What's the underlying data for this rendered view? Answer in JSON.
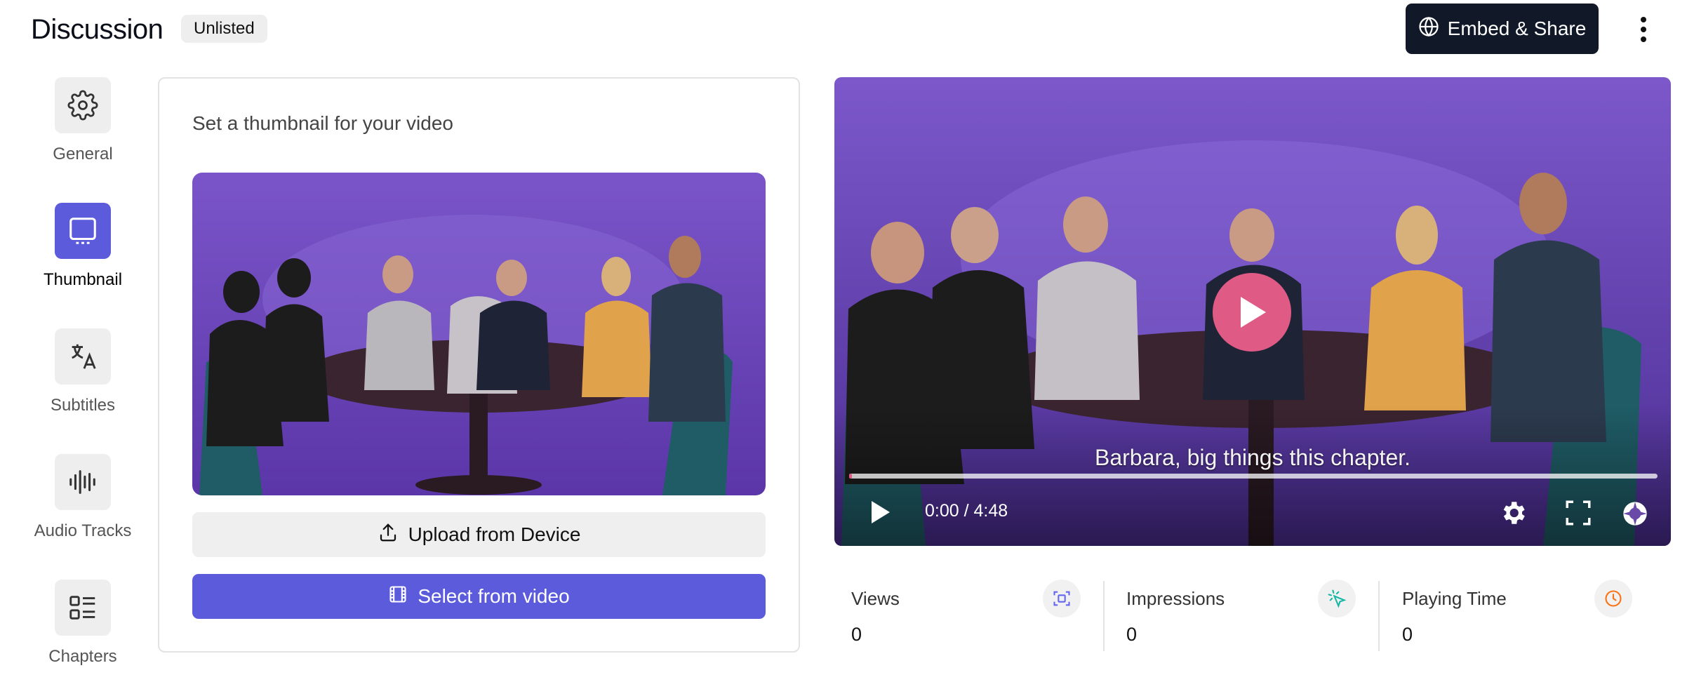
{
  "header": {
    "title": "Discussion",
    "badge": "Unlisted",
    "embed_label": "Embed & Share"
  },
  "sidebar": {
    "items": [
      {
        "label": "General",
        "icon": "gear-icon",
        "active": false
      },
      {
        "label": "Thumbnail",
        "icon": "monitor-icon",
        "active": true
      },
      {
        "label": "Subtitles",
        "icon": "translate-icon",
        "active": false
      },
      {
        "label": "Audio Tracks",
        "icon": "waveform-icon",
        "active": false
      },
      {
        "label": "Chapters",
        "icon": "list-icon",
        "active": false
      }
    ]
  },
  "thumbnail_panel": {
    "title": "Set a thumbnail for your video",
    "upload_label": "Upload from Device",
    "select_label": "Select from video"
  },
  "player": {
    "caption": "Barbara, big things this chapter.",
    "time": "0:00 / 4:48",
    "progress": 0
  },
  "stats": [
    {
      "label": "Views",
      "value": "0",
      "icon": "scan-icon"
    },
    {
      "label": "Impressions",
      "value": "0",
      "icon": "cursor-click-icon"
    },
    {
      "label": "Playing Time",
      "value": "0",
      "icon": "clock-icon"
    }
  ],
  "colors": {
    "accent": "#5b5bdc",
    "dark": "#111827",
    "play_pink": "#e05a86",
    "impressions_teal": "#14b8a6",
    "playing_time_orange": "#f97316",
    "views_indigo": "#6366f1"
  }
}
